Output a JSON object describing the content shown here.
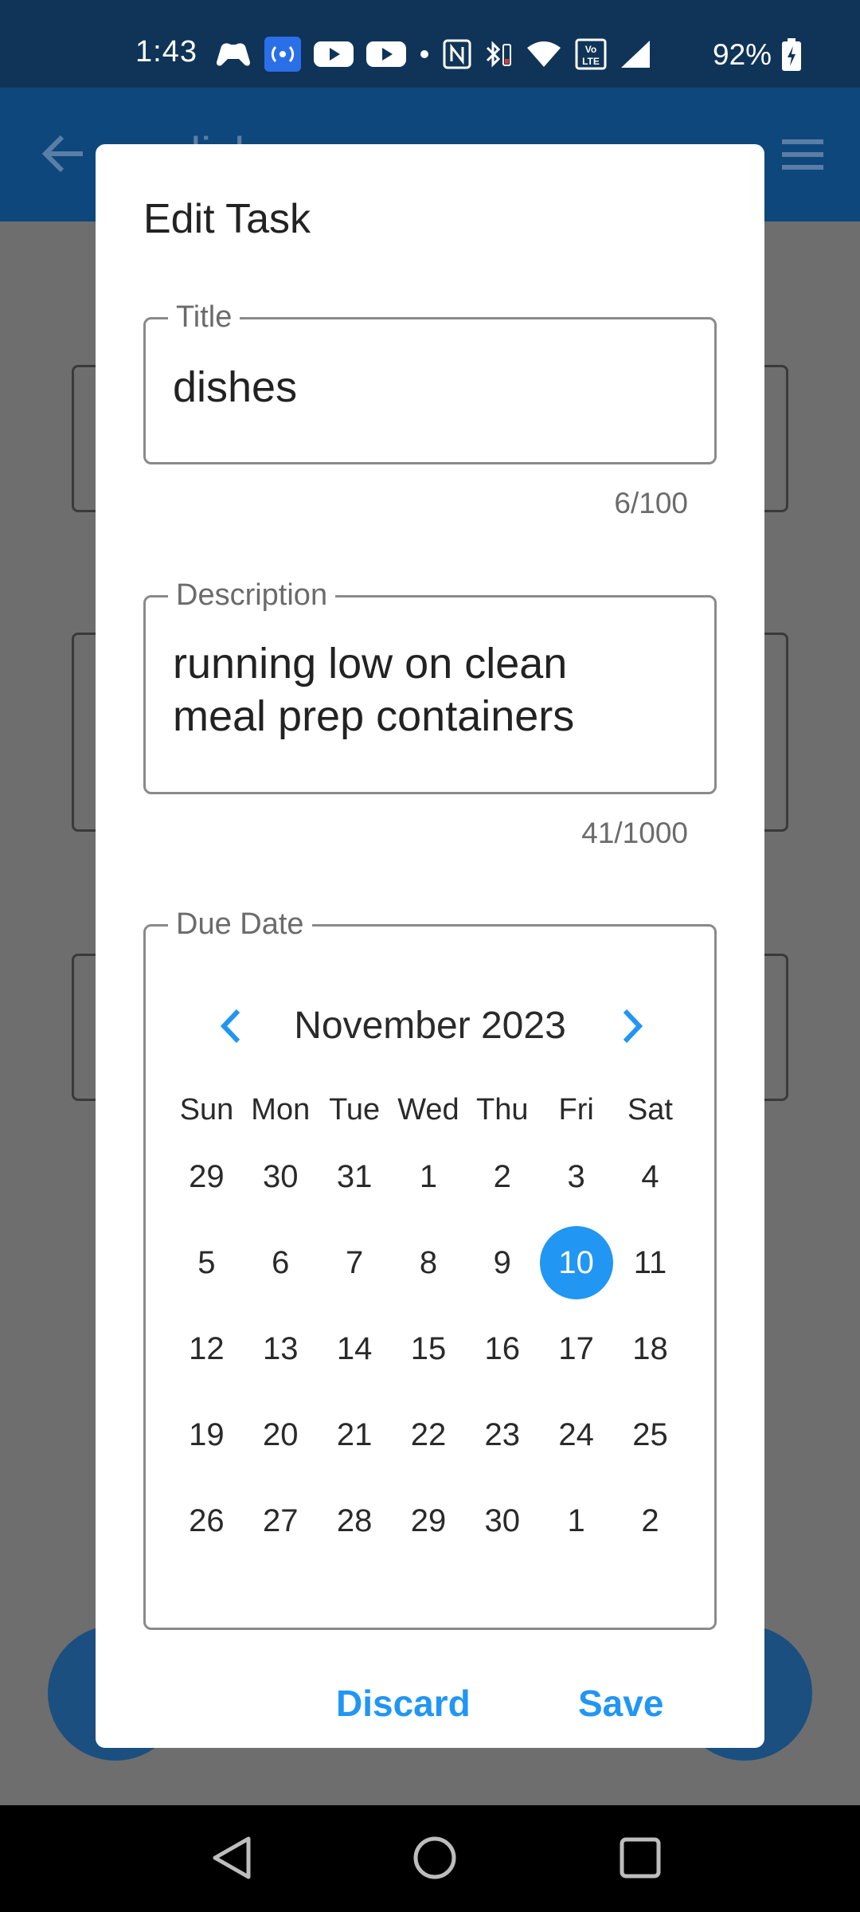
{
  "status_bar": {
    "time": "1:43",
    "battery_pct": "92%",
    "icons": [
      "game-controller-icon",
      "hotspot-icon",
      "youtube-icon",
      "youtube-icon",
      "dot-icon",
      "nfc-icon",
      "bluetooth-battery-icon",
      "wifi-icon",
      "volte-icon",
      "signal-icon",
      "battery-charging-icon"
    ]
  },
  "app_bar": {
    "title": "dishes"
  },
  "dialog": {
    "title": "Edit Task",
    "title_field": {
      "label": "Title",
      "value": "dishes",
      "counter": "6/100"
    },
    "description_field": {
      "label": "Description",
      "value": "running low on clean\nmeal prep containers",
      "counter": "41/1000"
    },
    "due_date": {
      "label": "Due Date",
      "month": "November 2023",
      "weekdays": [
        "Sun",
        "Mon",
        "Tue",
        "Wed",
        "Thu",
        "Fri",
        "Sat"
      ],
      "weeks": [
        [
          "29",
          "30",
          "31",
          "1",
          "2",
          "3",
          "4"
        ],
        [
          "5",
          "6",
          "7",
          "8",
          "9",
          "10",
          "11"
        ],
        [
          "12",
          "13",
          "14",
          "15",
          "16",
          "17",
          "18"
        ],
        [
          "19",
          "20",
          "21",
          "22",
          "23",
          "24",
          "25"
        ],
        [
          "26",
          "27",
          "28",
          "29",
          "30",
          "1",
          "2"
        ]
      ],
      "selected": "10"
    },
    "discard_label": "Discard",
    "save_label": "Save"
  },
  "colors": {
    "accent": "#2196f3",
    "status_bar": "#0f3457",
    "app_bar": "#0e477c",
    "scrim": "#6e6e6e"
  }
}
